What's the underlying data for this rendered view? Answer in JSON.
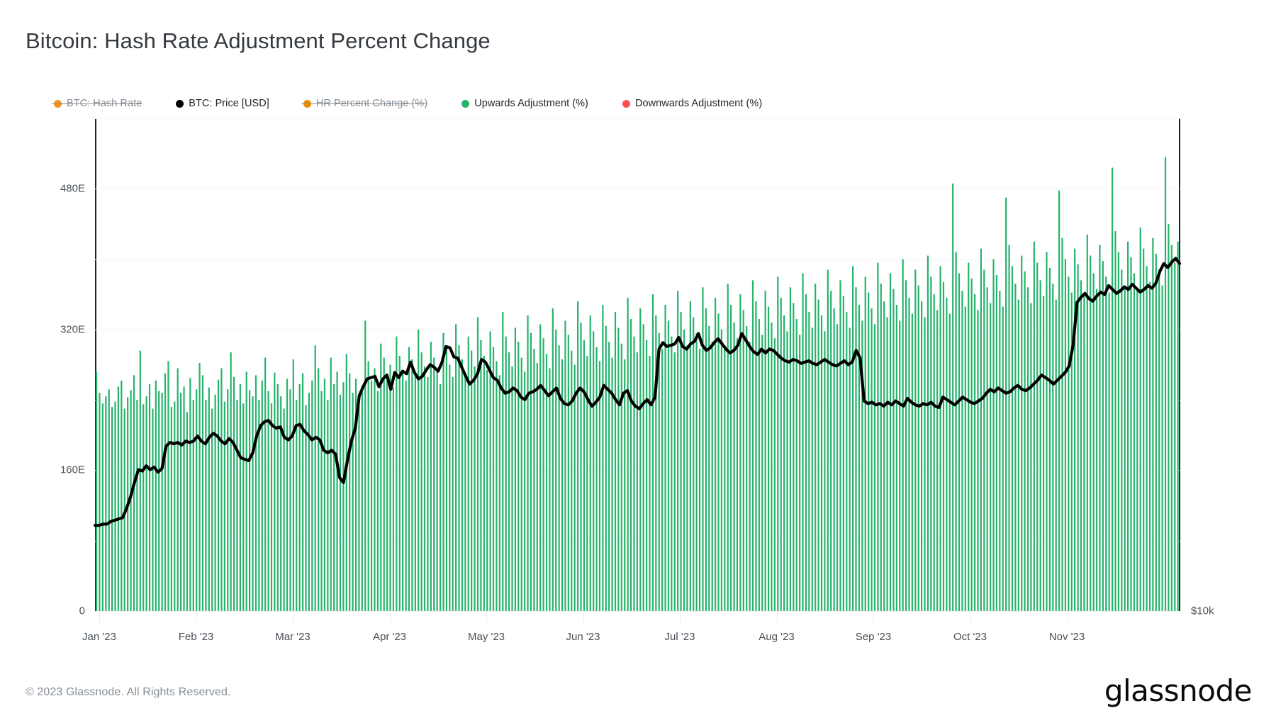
{
  "title": "Bitcoin: Hash Rate Adjustment Percent Change",
  "footer": {
    "copyright": "© 2023 Glassnode. All Rights Reserved.",
    "brand": "glassnode"
  },
  "legend": {
    "items": [
      {
        "label": "BTC: Hash Rate",
        "color": "#f7931a",
        "active": false
      },
      {
        "label": "BTC: Price [USD]",
        "color": "#000000",
        "active": true
      },
      {
        "label": "HR Percent Change (%)",
        "color": "#f08c00",
        "active": false
      },
      {
        "label": "Upwards Adjustment (%)",
        "color": "#26b36b",
        "active": true
      },
      {
        "label": "Downwards Adjustment (%)",
        "color": "#fa5252",
        "active": true
      }
    ]
  },
  "chart_data": {
    "type": "bar",
    "title": "Bitcoin: Hash Rate Adjustment Percent Change",
    "xlabel": "",
    "ylabel": "",
    "grid": true,
    "legend_position": "top-left",
    "y_left": {
      "ticks": [
        "0",
        "160E",
        "320E",
        "480E"
      ],
      "tick_values": [
        0,
        160,
        320,
        480
      ],
      "range": [
        0,
        560
      ],
      "unit": "E (EH/s)"
    },
    "y_right": {
      "ticks": [
        "$10k"
      ],
      "tick_values": [
        10
      ],
      "range": [
        10,
        48
      ],
      "unit": "USD thousands"
    },
    "x_axis": {
      "ticks": [
        "Jan '23",
        "Feb '23",
        "Mar '23",
        "Apr '23",
        "May '23",
        "Jun '23",
        "Jul '23",
        "Aug '23",
        "Sep '23",
        "Oct '23",
        "Nov '23"
      ],
      "range": [
        "2023-01-01",
        "2023-11-09"
      ]
    },
    "series": [
      {
        "name": "Upwards Adjustment (%)",
        "type": "bar",
        "color": "#26b36b",
        "axis": "left",
        "note": "Daily bars; heights in E units on left axis",
        "values": [
          272,
          248,
          236,
          244,
          252,
          232,
          238,
          255,
          262,
          230,
          243,
          251,
          268,
          240,
          296,
          235,
          244,
          258,
          230,
          262,
          250,
          248,
          270,
          284,
          232,
          238,
          276,
          248,
          255,
          226,
          265,
          240,
          252,
          282,
          268,
          240,
          254,
          230,
          246,
          263,
          276,
          238,
          252,
          294,
          266,
          240,
          258,
          236,
          272,
          251,
          244,
          268,
          240,
          262,
          288,
          250,
          236,
          271,
          258,
          244,
          230,
          264,
          252,
          286,
          240,
          258,
          270,
          234,
          248,
          262,
          302,
          276,
          250,
          264,
          240,
          288,
          258,
          272,
          246,
          260,
          292,
          270,
          248,
          264,
          240,
          256,
          330,
          284,
          262,
          276,
          250,
          304,
          288,
          268,
          280,
          254,
          312,
          290,
          274,
          262,
          300,
          286,
          268,
          320,
          294,
          278,
          266,
          306,
          288,
          272,
          258,
          316,
          298,
          280,
          266,
          326,
          302,
          286,
          270,
          312,
          296,
          278,
          334,
          308,
          290,
          274,
          318,
          300,
          284,
          268,
          340,
          312,
          294,
          278,
          322,
          306,
          288,
          272,
          336,
          316,
          298,
          282,
          326,
          310,
          292,
          276,
          344,
          320,
          302,
          286,
          330,
          314,
          296,
          280,
          352,
          328,
          308,
          290,
          336,
          318,
          300,
          284,
          348,
          324,
          306,
          288,
          340,
          322,
          304,
          286,
          356,
          332,
          312,
          294,
          344,
          326,
          308,
          290,
          360,
          336,
          316,
          298,
          348,
          330,
          312,
          294,
          364,
          340,
          320,
          302,
          352,
          334,
          316,
          298,
          368,
          344,
          324,
          306,
          356,
          338,
          320,
          302,
          372,
          348,
          328,
          310,
          360,
          342,
          324,
          306,
          376,
          352,
          332,
          314,
          364,
          346,
          328,
          310,
          380,
          356,
          336,
          318,
          368,
          350,
          332,
          314,
          384,
          360,
          340,
          322,
          372,
          354,
          336,
          318,
          388,
          364,
          344,
          326,
          376,
          358,
          340,
          322,
          392,
          368,
          348,
          330,
          380,
          362,
          344,
          326,
          396,
          372,
          352,
          334,
          384,
          366,
          348,
          330,
          400,
          376,
          356,
          338,
          388,
          370,
          352,
          334,
          404,
          380,
          360,
          342,
          392,
          374,
          356,
          338,
          486,
          408,
          384,
          364,
          346,
          396,
          378,
          360,
          342,
          412,
          388,
          368,
          350,
          400,
          382,
          364,
          346,
          470,
          416,
          392,
          372,
          354,
          404,
          386,
          368,
          350,
          420,
          396,
          376,
          358,
          408,
          390,
          372,
          354,
          478,
          424,
          400,
          380,
          362,
          412,
          394,
          376,
          358,
          428,
          404,
          384,
          366,
          416,
          398,
          380,
          362,
          504,
          432,
          408,
          388,
          370,
          420,
          402,
          384,
          366,
          436,
          412,
          392,
          374,
          424,
          406,
          388,
          370,
          516,
          440,
          416,
          396,
          420
        ]
      },
      {
        "name": "Downwards Adjustment (%)",
        "type": "bar",
        "color": "#fa5252",
        "axis": "left",
        "values": []
      },
      {
        "name": "BTC: Price [USD]",
        "type": "line",
        "color": "#000000",
        "axis": "right",
        "note": "Thousands of USD; approx daily close",
        "values": [
          16.6,
          16.6,
          16.7,
          16.7,
          16.9,
          17.0,
          17.1,
          17.2,
          17.9,
          18.8,
          19.9,
          20.9,
          20.8,
          21.2,
          20.9,
          21.1,
          20.7,
          21.0,
          22.7,
          23.0,
          22.9,
          23.0,
          22.8,
          23.1,
          23.0,
          23.1,
          23.5,
          23.1,
          22.9,
          23.4,
          23.7,
          23.5,
          23.1,
          22.9,
          23.3,
          23.0,
          22.4,
          21.8,
          21.7,
          21.6,
          22.2,
          23.5,
          24.3,
          24.6,
          24.7,
          24.3,
          24.1,
          24.2,
          23.4,
          23.2,
          23.5,
          24.3,
          24.4,
          23.9,
          23.6,
          23.2,
          23.4,
          23.2,
          22.4,
          22.2,
          22.4,
          22.1,
          20.3,
          19.9,
          21.6,
          23.1,
          24.1,
          26.6,
          27.3,
          27.9,
          28.0,
          28.1,
          27.3,
          27.9,
          28.2,
          27.1,
          28.4,
          28.0,
          28.5,
          28.3,
          29.2,
          28.4,
          27.9,
          28.1,
          28.6,
          29.0,
          28.8,
          28.5,
          29.2,
          30.4,
          30.3,
          29.6,
          29.5,
          28.8,
          28.1,
          27.5,
          27.8,
          28.3,
          29.4,
          29.2,
          28.6,
          28.0,
          27.8,
          27.2,
          26.8,
          26.9,
          27.2,
          27.0,
          26.5,
          26.3,
          26.8,
          26.9,
          27.1,
          27.4,
          27.0,
          26.6,
          26.9,
          27.2,
          26.4,
          26.0,
          25.9,
          26.2,
          26.8,
          27.2,
          26.9,
          26.3,
          25.8,
          26.1,
          26.5,
          27.4,
          27.1,
          26.8,
          26.3,
          25.9,
          26.8,
          27.0,
          26.2,
          25.8,
          25.6,
          26.0,
          26.3,
          25.9,
          26.5,
          30.2,
          30.7,
          30.4,
          30.5,
          30.6,
          31.1,
          30.4,
          30.2,
          30.6,
          30.8,
          31.4,
          30.5,
          30.1,
          30.3,
          30.7,
          31.0,
          30.6,
          30.2,
          29.9,
          30.1,
          30.5,
          31.4,
          30.9,
          30.4,
          30.0,
          29.8,
          30.2,
          29.9,
          30.2,
          30.1,
          29.8,
          29.5,
          29.3,
          29.2,
          29.4,
          29.3,
          29.1,
          29.2,
          29.3,
          29.1,
          29.0,
          29.2,
          29.4,
          29.2,
          29.0,
          28.9,
          29.1,
          29.3,
          29.0,
          29.2,
          30.1,
          29.5,
          26.2,
          26.0,
          26.1,
          25.9,
          26.0,
          25.8,
          26.1,
          25.9,
          26.2,
          26.0,
          25.8,
          26.4,
          26.1,
          25.9,
          25.8,
          26.0,
          25.9,
          26.1,
          25.8,
          25.7,
          26.5,
          26.3,
          26.1,
          25.9,
          26.2,
          26.5,
          26.3,
          26.1,
          26.0,
          26.2,
          26.4,
          26.8,
          27.1,
          26.9,
          27.2,
          27.0,
          26.8,
          26.9,
          27.2,
          27.4,
          27.1,
          27.0,
          27.2,
          27.5,
          27.8,
          28.2,
          28.0,
          27.8,
          27.5,
          27.8,
          28.1,
          28.4,
          28.9,
          30.5,
          33.8,
          34.2,
          34.5,
          34.1,
          33.9,
          34.3,
          34.6,
          34.4,
          35.1,
          34.8,
          34.5,
          34.7,
          35.0,
          34.8,
          35.2,
          34.9,
          34.6,
          34.8,
          35.1,
          34.9,
          35.3,
          36.2,
          36.8,
          36.5,
          36.9,
          37.2,
          36.8
        ]
      }
    ]
  }
}
